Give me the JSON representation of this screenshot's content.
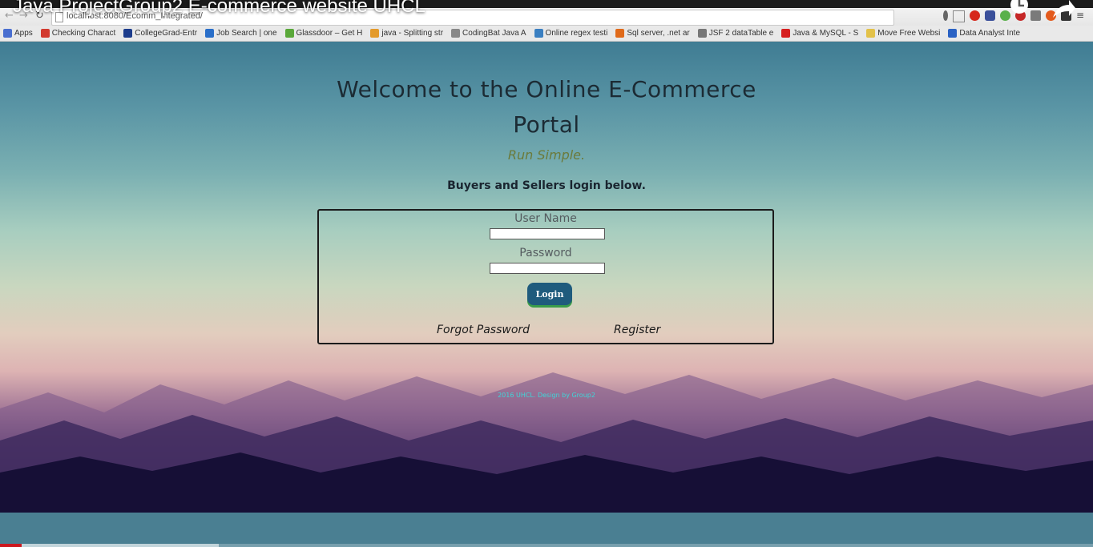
{
  "video": {
    "title": "Java ProjectGroup2 E-commerce website UHCL",
    "progress_percent": 2,
    "buffered_percent": 20
  },
  "browser": {
    "url": "localhost:8080/Ecomm_Integrated/",
    "bookmarks": [
      {
        "label": "Apps",
        "color": "#4a6fd0"
      },
      {
        "label": "Checking Charact",
        "color": "#d23a2f"
      },
      {
        "label": "CollegeGrad-Entr",
        "color": "#1c3c8c"
      },
      {
        "label": "Job Search | one",
        "color": "#2a6fc9"
      },
      {
        "label": "Glassdoor – Get H",
        "color": "#5aa83a"
      },
      {
        "label": "java - Splitting str",
        "color": "#e39a2b"
      },
      {
        "label": "CodingBat Java A",
        "color": "#888888"
      },
      {
        "label": "Online regex testi",
        "color": "#3a7fc1"
      },
      {
        "label": "Sql server, .net ar",
        "color": "#e06a1a"
      },
      {
        "label": "JSF 2 dataTable e",
        "color": "#777777"
      },
      {
        "label": "Java & MySQL - S",
        "color": "#d61f1f"
      },
      {
        "label": "Move Free Websi",
        "color": "#e3c24a"
      },
      {
        "label": "Data Analyst Inte",
        "color": "#2a62c4"
      }
    ]
  },
  "page": {
    "heading": "Welcome to the Online E-Commerce Portal",
    "tagline": "Run Simple.",
    "login_note": "Buyers and Sellers login below.",
    "username_label": "User Name",
    "password_label": "Password",
    "login_button": "Login",
    "forgot_password": "Forgot Password",
    "register": "Register",
    "footer": "2016 UHCL. Design by Group2"
  },
  "colors": {
    "accent_button": "#1f5b7d",
    "footer_text": "#3fd6d8",
    "progress": "#cc181e"
  }
}
